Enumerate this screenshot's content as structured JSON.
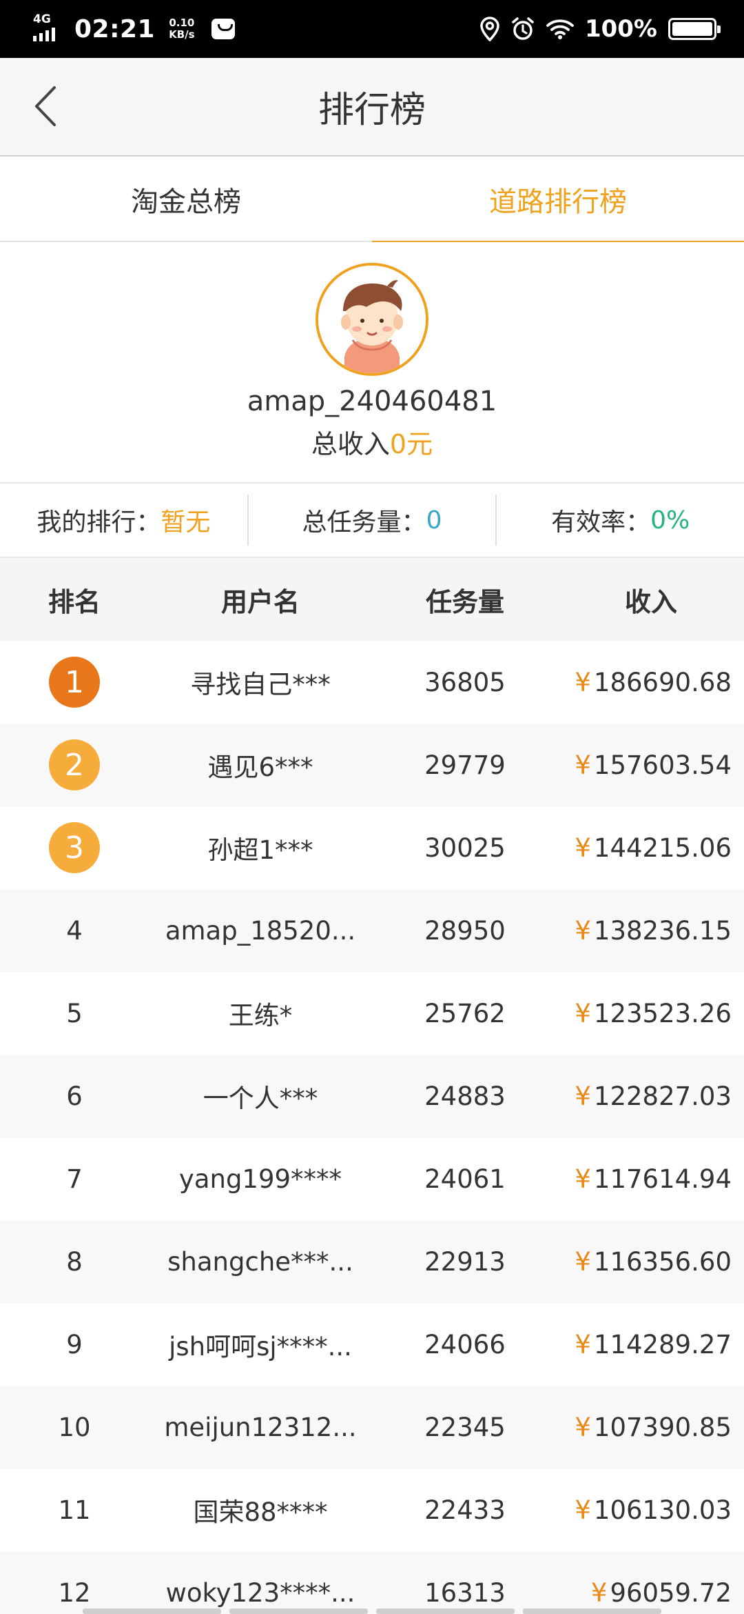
{
  "status_bar": {
    "network": "4G",
    "time": "02:21",
    "speed_value": "0.10",
    "speed_unit": "KB/s",
    "battery": "100%"
  },
  "header": {
    "title": "排行榜"
  },
  "tabs": [
    {
      "label": "淘金总榜",
      "active": false
    },
    {
      "label": "道路排行榜",
      "active": true
    }
  ],
  "profile": {
    "username": "amap_240460481",
    "income_label": "总收入",
    "income_value": "0元"
  },
  "stats": {
    "rank_label": "我的排行：",
    "rank_value": "暂无",
    "tasks_label": "总任务量：",
    "tasks_value": "0",
    "rate_label": "有效率：",
    "rate_value": "0%"
  },
  "table": {
    "headers": [
      "排名",
      "用户名",
      "任务量",
      "收入"
    ],
    "currency": "¥",
    "rows": [
      {
        "rank": "1",
        "name": "寻找自己***",
        "tasks": "36805",
        "income": "186690.68"
      },
      {
        "rank": "2",
        "name": "遇见6***",
        "tasks": "29779",
        "income": "157603.54"
      },
      {
        "rank": "3",
        "name": "孙超1***",
        "tasks": "30025",
        "income": "144215.06"
      },
      {
        "rank": "4",
        "name": "amap_18520...",
        "tasks": "28950",
        "income": "138236.15"
      },
      {
        "rank": "5",
        "name": "王练*",
        "tasks": "25762",
        "income": "123523.26"
      },
      {
        "rank": "6",
        "name": "一个人***",
        "tasks": "24883",
        "income": "122827.03"
      },
      {
        "rank": "7",
        "name": "yang199****",
        "tasks": "24061",
        "income": "117614.94"
      },
      {
        "rank": "8",
        "name": "shangche***...",
        "tasks": "22913",
        "income": "116356.60"
      },
      {
        "rank": "9",
        "name": "jsh呵呵sj****...",
        "tasks": "24066",
        "income": "114289.27"
      },
      {
        "rank": "10",
        "name": "meijun12312...",
        "tasks": "22345",
        "income": "107390.85"
      },
      {
        "rank": "11",
        "name": "国荣88****",
        "tasks": "22433",
        "income": "106130.03"
      },
      {
        "rank": "12",
        "name": "woky123****...",
        "tasks": "16313",
        "income": "96059.72"
      }
    ]
  },
  "colors": {
    "accent": "#f0a21f",
    "gold_medal": "#e8771b",
    "silver_bronze_medal": "#f6ac3b",
    "blue_value": "#3ba6c9",
    "green_value": "#27b27e"
  }
}
